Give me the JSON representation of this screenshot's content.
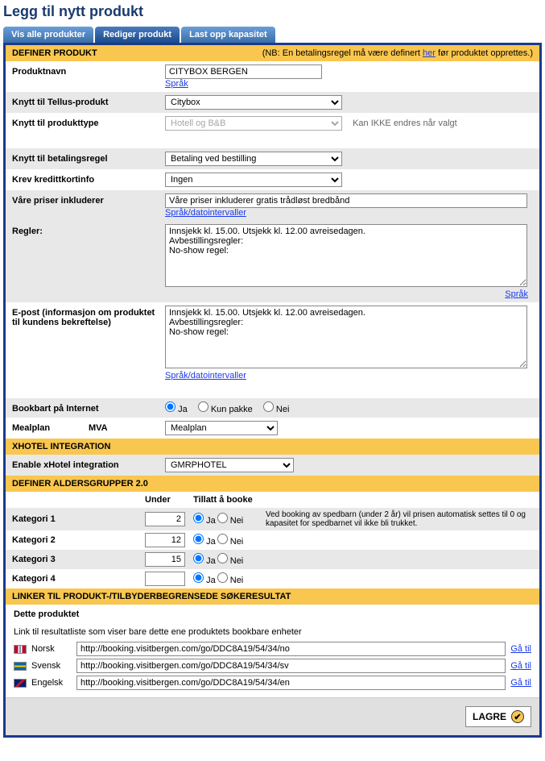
{
  "page_title": "Legg til nytt produkt",
  "tabs": {
    "all": "Vis alle produkter",
    "edit": "Rediger produkt",
    "upload": "Last opp kapasitet"
  },
  "section_define": {
    "title": "DEFINER PRODUKT",
    "note_pre": "(NB: En betalingsregel må være definert ",
    "note_link": "her",
    "note_post": " før produktet opprettes.)"
  },
  "fields": {
    "productname_label": "Produktnavn",
    "productname_value": "CITYBOX BERGEN",
    "lang_link": "Språk",
    "tellus_label": "Knytt til Tellus-produkt",
    "tellus_value": "Citybox",
    "ptype_label": "Knytt til produkttype",
    "ptype_value": "Hotell og B&B",
    "ptype_hint": "Kan IKKE endres når valgt",
    "payrule_label": "Knytt til betalingsregel",
    "payrule_value": "Betaling ved bestilling",
    "cc_label": "Krev kredittkortinfo",
    "cc_value": "Ingen",
    "prices_label": "Våre priser inkluderer",
    "prices_value": "Våre priser inkluderer gratis trådløst bredbånd",
    "langdate_link": "Språk/datointervaller",
    "rules_label": "Regler:",
    "rules_value": "Innsjekk kl. 15.00. Utsjekk kl. 12.00 avreisedagen.\nAvbestillingsregler:\nNo-show regel:",
    "email_label": "E-post (informasjon om produktet til kundens bekreftelse)",
    "email_value": "Innsjekk kl. 15.00. Utsjekk kl. 12.00 avreisedagen.\nAvbestillingsregler:\nNo-show regel:",
    "bookable_label": "Bookbart på Internet",
    "opt_ja": "Ja",
    "opt_kun": "Kun pakke",
    "opt_nei": "Nei",
    "mealplan_label": "Mealplan",
    "mva_label": "MVA",
    "mealplan_value": "Mealplan"
  },
  "section_xhotel": {
    "title": "XHOTEL INTEGRATION",
    "enable_label": "Enable xHotel integration",
    "enable_value": "GMRPHOTEL"
  },
  "section_age": {
    "title": "DEFINER ALDERSGRUPPER 2.0",
    "col_under": "Under",
    "col_allow": "Tillatt å booke",
    "cat1": "Kategori 1",
    "v1": "2",
    "cat2": "Kategori 2",
    "v2": "12",
    "cat3": "Kategori 3",
    "v3": "15",
    "cat4": "Kategori 4",
    "v4": "",
    "ja": "Ja",
    "nei": "Nei",
    "note": "Ved booking av spedbarn (under 2 år) vil prisen automatisk settes til 0 og kapasitet for spedbarnet vil ikke bli trukket."
  },
  "section_links": {
    "title": "LINKER TIL PRODUKT-/TILBYDERBEGRENSEDE SØKERESULTAT",
    "sub": "Dette produktet",
    "desc": "Link til resultatliste som viser bare dette ene produktets bookbare enheter",
    "no_label": "Norsk",
    "sv_label": "Svensk",
    "en_label": "Engelsk",
    "no_url": "http://booking.visitbergen.com/go/DDC8A19/54/34/no",
    "sv_url": "http://booking.visitbergen.com/go/DDC8A19/54/34/sv",
    "en_url": "http://booking.visitbergen.com/go/DDC8A19/54/34/en",
    "go": "Gå til"
  },
  "save_label": "LAGRE"
}
